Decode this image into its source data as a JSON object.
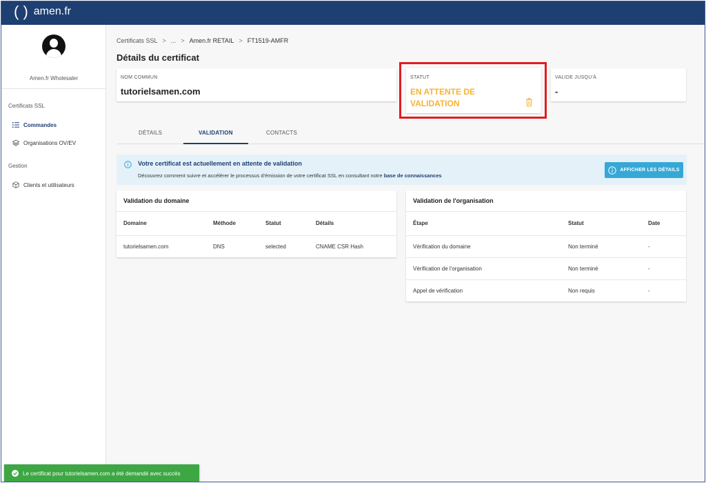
{
  "brand": {
    "logo_paren": "( )",
    "logo_text": "amen.fr"
  },
  "sidebar": {
    "account_name": "Amen.fr Wholesaler",
    "sections": [
      {
        "title": "Certificats SSL",
        "items": [
          {
            "label": "Commandes",
            "icon": "list-icon",
            "active": true
          },
          {
            "label": "Organisations OV/EV",
            "icon": "layers-icon",
            "active": false
          }
        ]
      },
      {
        "title": "Gestion",
        "items": [
          {
            "label": "Clients et utilisateurs",
            "icon": "box-icon",
            "active": false
          }
        ]
      }
    ]
  },
  "breadcrumb": [
    "Certificats SSL",
    "...",
    "Amen.fr RETAIL",
    "FT1519-AMFR"
  ],
  "page_title": "Détails du certificat",
  "summary": {
    "common_name_label": "NOM COMMUN",
    "common_name_value": "tutorielsamen.com",
    "status_label": "STATUT",
    "status_value": "EN ATTENTE DE VALIDATION",
    "valid_until_label": "VALIDE JUSQU'À",
    "valid_until_value": "-"
  },
  "tabs": [
    {
      "label": "DÉTAILS",
      "active": false
    },
    {
      "label": "VALIDATION",
      "active": true
    },
    {
      "label": "CONTACTS",
      "active": false
    }
  ],
  "info": {
    "title": "Votre certificat est actuellement en attente de validation",
    "text": "Découvrez comment suivre et accélérer le processus d'émission de votre certificat SSL en consultant notre",
    "link": "base de connaissances",
    "button": "AFFICHER LES DÉTAILS"
  },
  "domain_validation": {
    "title": "Validation du domaine",
    "headers": [
      "Domaine",
      "Méthode",
      "Statut",
      "Détails"
    ],
    "rows": [
      [
        "tutorielsamen.com",
        "DNS",
        "selected",
        "CNAME CSR Hash"
      ]
    ]
  },
  "org_validation": {
    "title": "Validation de l'organisation",
    "headers": [
      "Étape",
      "Statut",
      "Date"
    ],
    "rows": [
      [
        "Vérification du domaine",
        "Non terminé",
        "-"
      ],
      [
        "Vérification de l'organisation",
        "Non terminé",
        "-"
      ],
      [
        "Appel de vérification",
        "Non requis",
        "-"
      ]
    ]
  },
  "toast": {
    "message": "Le certificat pour tutorielsamen.com a été demandé avec succès"
  },
  "colors": {
    "topbar": "#1e3f72",
    "status": "#f5b335",
    "highlight": "#e21a22",
    "button": "#36a8d6",
    "toast": "#3da743"
  }
}
